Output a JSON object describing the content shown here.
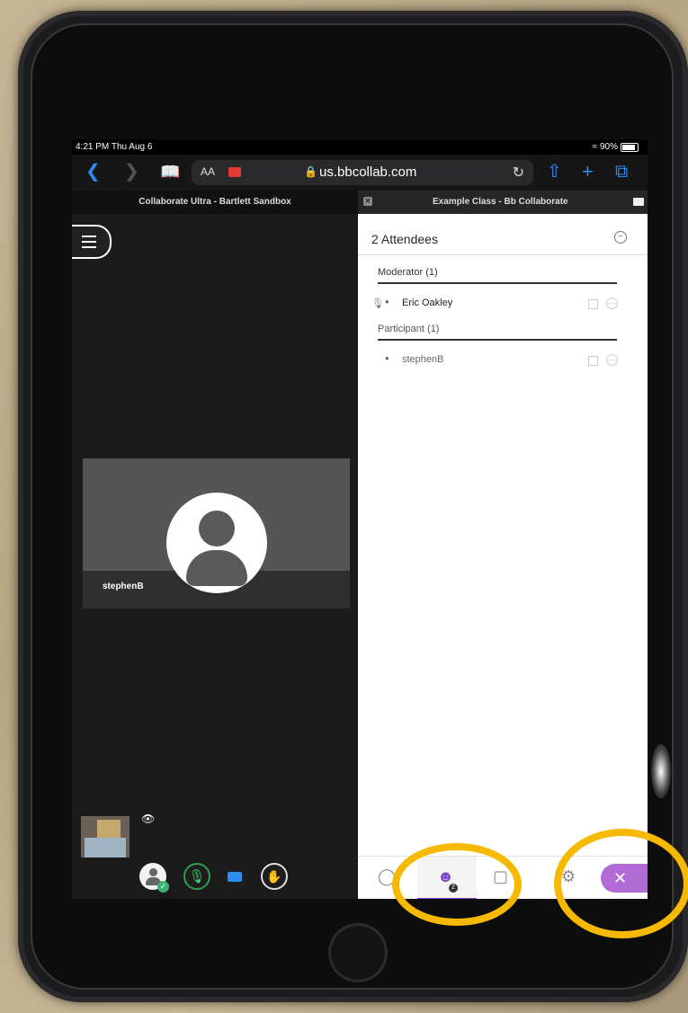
{
  "status_bar": {
    "time": "4:21 PM  Thu Aug 6",
    "battery": "90%"
  },
  "browser": {
    "text_size_label": "AA",
    "url": "us.bbcollab.com",
    "tabs": [
      {
        "title": "Collaborate Ultra - Bartlett Sandbox"
      },
      {
        "title": "Example Class - Bb Collaborate"
      }
    ]
  },
  "session": {
    "video_tile_name": "stephenB"
  },
  "attendees_panel": {
    "title": "2 Attendees",
    "groups": [
      {
        "label": "Moderator (1)",
        "members": [
          {
            "name": "Eric Oakley",
            "has_mic": true
          }
        ]
      },
      {
        "label": "Participant (1)",
        "members": [
          {
            "name": "stephenB",
            "has_mic": false
          }
        ]
      }
    ],
    "attendee_count_badge": "2"
  },
  "colors": {
    "accent_purple": "#7a47c6",
    "close_button": "#b26bd6",
    "safari_blue": "#2e8cf5",
    "highlight": "#f7b900"
  }
}
